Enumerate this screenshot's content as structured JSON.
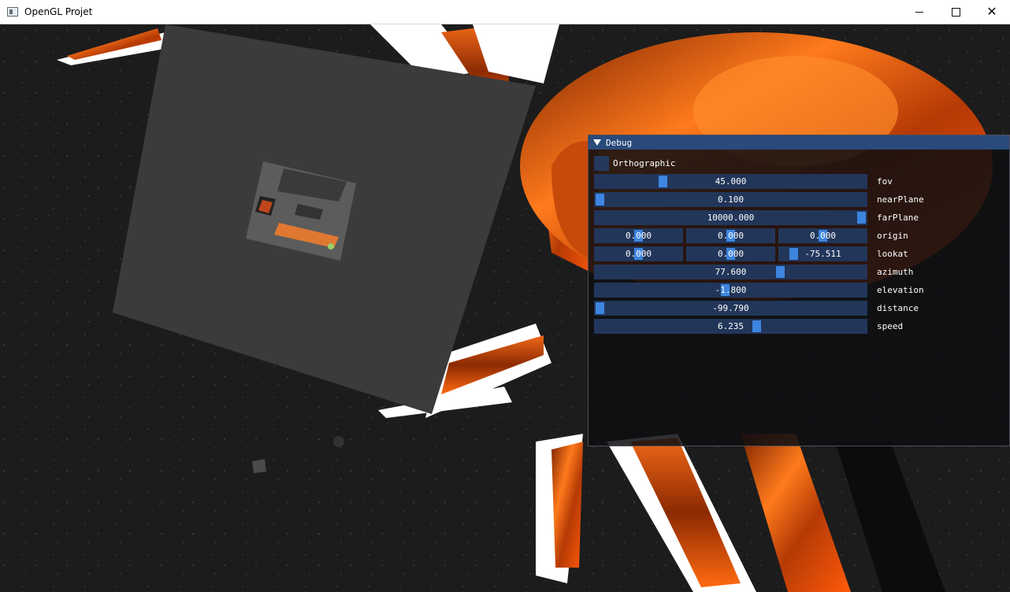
{
  "window": {
    "title": "OpenGL Projet",
    "buttons": {
      "minimize_icon": "minimize-icon",
      "maximize_icon": "maximize-icon",
      "close_icon": "close-icon",
      "close_glyph": "✕"
    }
  },
  "debug": {
    "header": "Debug",
    "orthographic_label": "Orthographic",
    "orthographic_checked": false,
    "fov": {
      "value": "45.000",
      "label": "fov",
      "level": 0.24
    },
    "nearPlane": {
      "value": "0.100",
      "label": "nearPlane",
      "level": 0.0
    },
    "farPlane": {
      "value": "10000.000",
      "label": "farPlane",
      "level": 1.0
    },
    "origin": {
      "x": "0.000",
      "y": "0.000",
      "z": "0.000",
      "label": "origin",
      "levels": [
        0.5,
        0.5,
        0.5
      ]
    },
    "lookat": {
      "x": "0.000",
      "y": "0.000",
      "z": "-75.511",
      "label": "lookat",
      "levels": [
        0.5,
        0.5,
        0.12
      ]
    },
    "azimuth": {
      "value": "77.600",
      "label": "azimuth",
      "level": 0.69
    },
    "elevation": {
      "value": "-1.800",
      "label": "elevation",
      "level": 0.48
    },
    "distance": {
      "value": "-99.790",
      "label": "distance",
      "level": 0.0
    },
    "speed": {
      "value": "6.235",
      "label": "speed",
      "level": 0.6
    }
  },
  "colors": {
    "accent": "#3d85e0",
    "slider_bg": "#22365a",
    "header": "#294a7a",
    "lava": "#e8560e"
  }
}
